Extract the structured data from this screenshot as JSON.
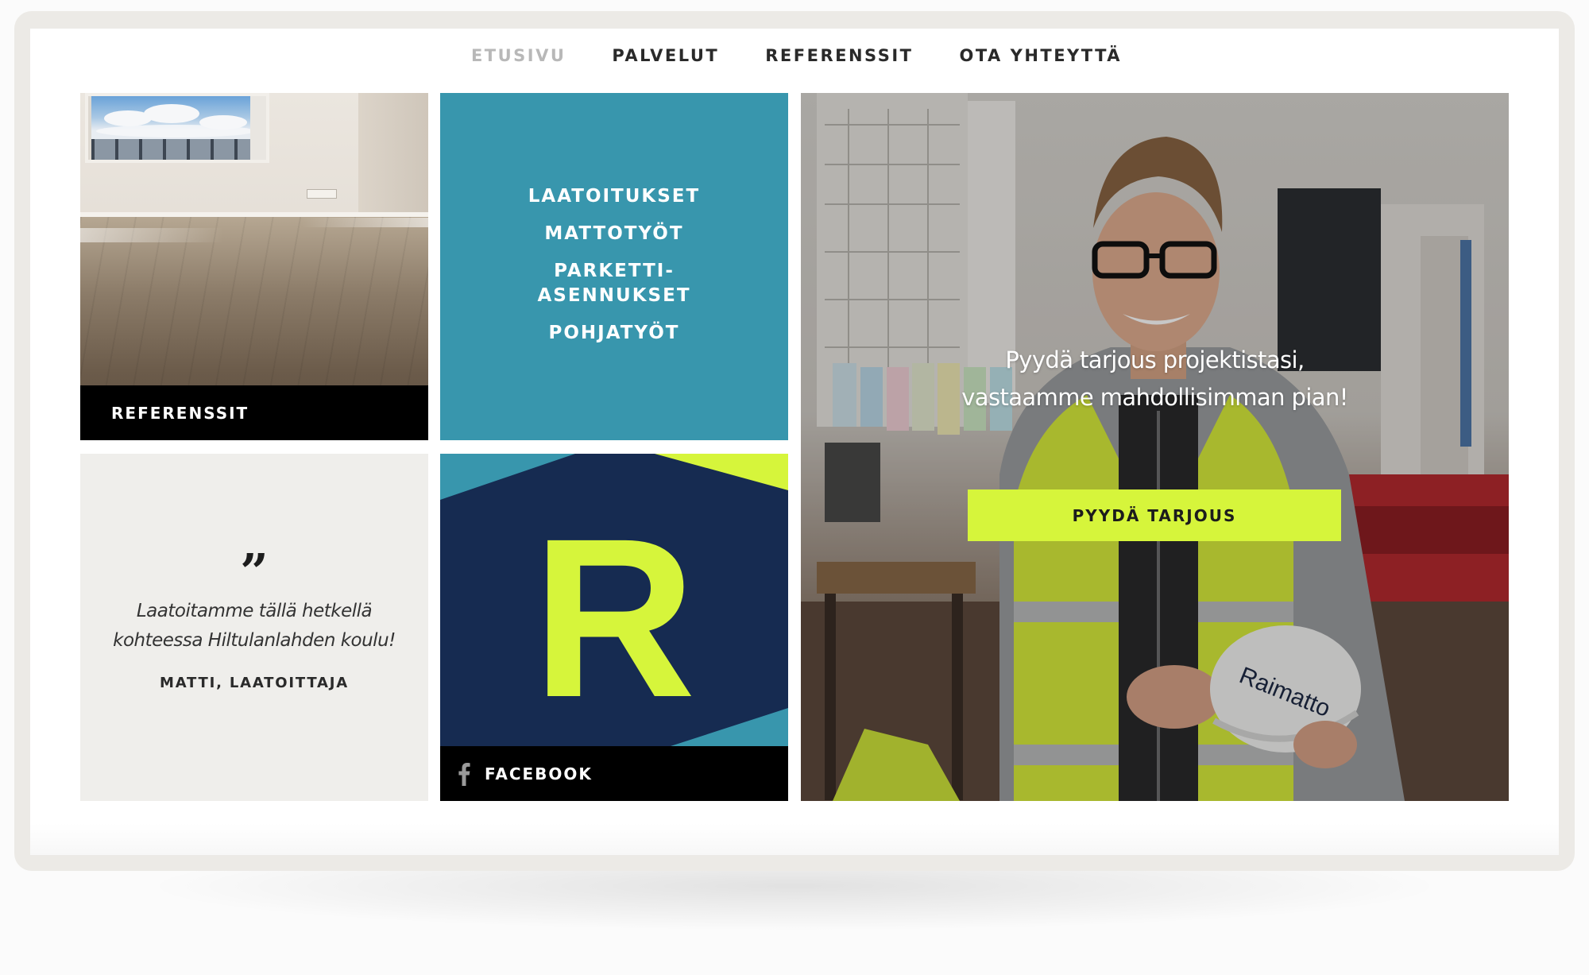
{
  "nav": {
    "items": [
      {
        "label": "ETUSIVU",
        "active": true
      },
      {
        "label": "PALVELUT",
        "active": false
      },
      {
        "label": "REFERENSSIT",
        "active": false
      },
      {
        "label": "OTA YHTEYTTÄ",
        "active": false
      }
    ]
  },
  "references_tile": {
    "caption": "REFERENSSIT"
  },
  "services_tile": {
    "items": [
      "LAATOITUKSET",
      "MATTOTYÖT",
      "PARKETTI-\nASENNUKSET",
      "POHJATYÖT"
    ],
    "background": "#3896ad"
  },
  "quote_tile": {
    "mark": "”",
    "text": "Laatoitamme tällä hetkellä kohteessa Hiltulanlahden koulu!",
    "author": "MATTI, LAATOITTAJA"
  },
  "facebook_tile": {
    "logo_letter": "R",
    "caption": "FACEBOOK",
    "icon": "facebook-icon",
    "colors": {
      "navy": "#162b51",
      "lime": "#d6f53b",
      "teal": "#3896ad"
    }
  },
  "hero": {
    "text": "Pyydä tarjous projektistasi, vastaamme mahdollisimman pian!",
    "cta_label": "PYYDÄ TARJOUS",
    "helmet_text": "Raimatto",
    "cta_color": "#d6f53b"
  }
}
